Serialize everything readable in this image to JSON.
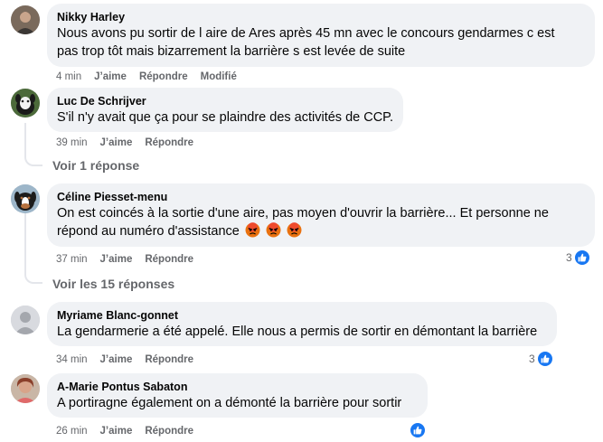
{
  "comments": [
    {
      "author": "Nikky Harley",
      "text_line1": "Nous avons pu sortir de l aire de Ares après 45 mn avec le concours gendarmes c est",
      "text_line2": "pas trop tôt mais bizarrement la barrière s est levée de suite",
      "time": "4 min",
      "like_label": "J’aime",
      "reply_label": "Répondre",
      "edited_label": "Modifié"
    },
    {
      "author": "Luc De Schrijver",
      "text": "S'il n'y avait que ça pour se plaindre des activités de CCP.",
      "time": "39 min",
      "like_label": "J’aime",
      "reply_label": "Répondre",
      "replies_label": "Voir 1 réponse"
    },
    {
      "author": "Céline Piesset-menu",
      "text_line1": "On est coincés à la sortie d'une aire, pas moyen d'ouvrir la barrière... Et personne ne",
      "text_line2": "répond au numéro d'assistance",
      "time": "37 min",
      "like_label": "J’aime",
      "reply_label": "Répondre",
      "reaction_count": "3",
      "replies_label": "Voir les 15 réponses"
    },
    {
      "author": "Myriame Blanc-gonnet",
      "text": "La gendarmerie a été appelé. Elle nous a permis de sortir en démontant la barrière",
      "time": "34 min",
      "like_label": "J’aime",
      "reply_label": "Répondre",
      "reaction_count": "3"
    },
    {
      "author": "A-Marie Pontus Sabaton",
      "text": "A portiragne également on a démonté la barrière pour sortir",
      "time": "26 min",
      "like_label": "J’aime",
      "reply_label": "Répondre"
    }
  ],
  "colors": {
    "bubble": "#f0f2f5",
    "meta": "#65676b",
    "like_blue": "#1877f2",
    "angry": "#e9710f"
  },
  "icons": {
    "reaction": "like-thumb-icon",
    "emoji": "angry-face-icon"
  }
}
